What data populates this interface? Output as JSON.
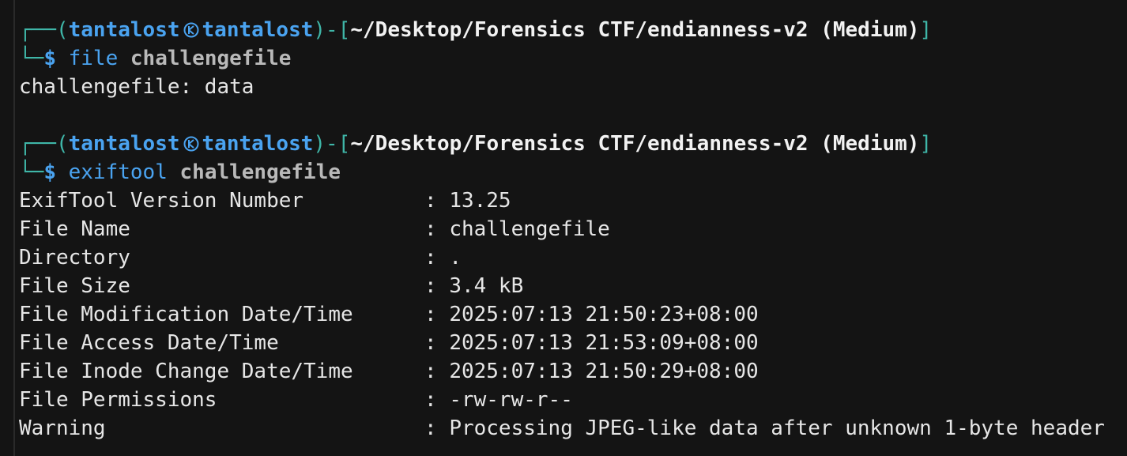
{
  "prompt": {
    "user": "tantalost",
    "host": "tantalost",
    "cwd": "~/Desktop/Forensics CTF/endianness-v2 (Medium)",
    "top_prefix": "┌──(",
    "top_mid": ")-[",
    "top_end": "]",
    "bottom_prefix": "└─",
    "dollar": "$"
  },
  "commands": [
    {
      "cmd": "file",
      "arg": "challengefile",
      "output": [
        "challengefile: data"
      ]
    },
    {
      "cmd": "exiftool",
      "arg": "challengefile",
      "rows": [
        {
          "key": "ExifTool Version Number",
          "value": "13.25"
        },
        {
          "key": "File Name",
          "value": "challengefile"
        },
        {
          "key": "Directory",
          "value": "."
        },
        {
          "key": "File Size",
          "value": "3.4 kB"
        },
        {
          "key": "File Modification Date/Time",
          "value": "2025:07:13 21:50:23+08:00"
        },
        {
          "key": "File Access Date/Time",
          "value": "2025:07:13 21:53:09+08:00"
        },
        {
          "key": "File Inode Change Date/Time",
          "value": "2025:07:13 21:50:29+08:00"
        },
        {
          "key": "File Permissions",
          "value": "-rw-rw-r--"
        },
        {
          "key": "Warning",
          "value": "Processing JPEG-like data after unknown 1-byte header"
        }
      ]
    }
  ],
  "separator": ": ",
  "colors": {
    "background": "#141414",
    "prompt_frame": "#3fb6a8",
    "user_host": "#4aa3f0",
    "path": "#f2f2f2",
    "command": "#4aa3f0",
    "argument": "#b9b9b9",
    "output": "#e6e6e6"
  },
  "icons": {
    "user_host_separator": "kali-skull-icon"
  }
}
